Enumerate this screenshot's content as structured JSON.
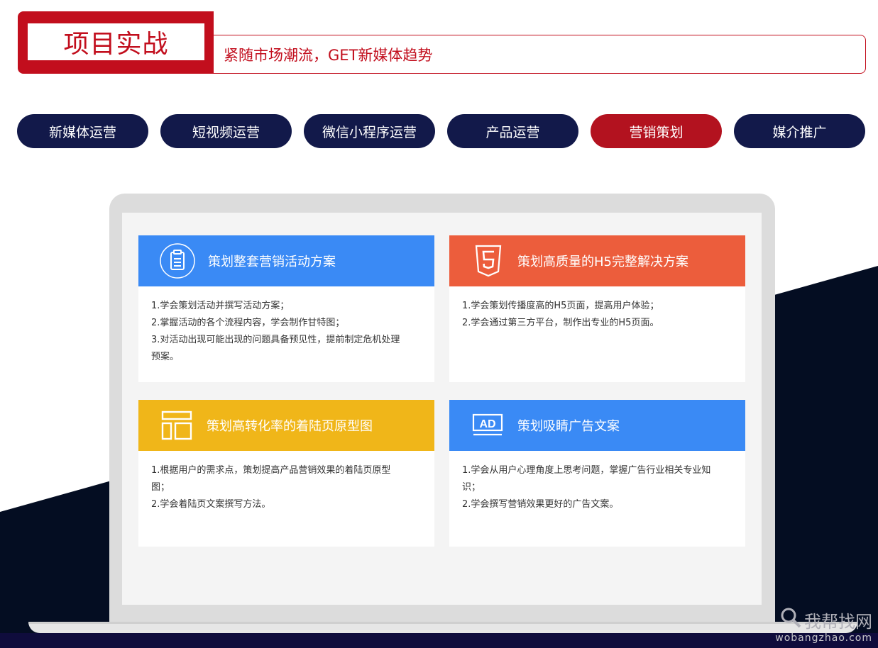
{
  "header": {
    "title": "项目实战",
    "subtitle": "紧随市场潮流，GET新媒体趋势"
  },
  "tabs": [
    {
      "label": "新媒体运营",
      "active": false
    },
    {
      "label": "短视频运营",
      "active": false
    },
    {
      "label": "微信小程序运营",
      "active": false
    },
    {
      "label": "产品运营",
      "active": false
    },
    {
      "label": "营销策划",
      "active": true
    },
    {
      "label": "媒介推广",
      "active": false
    }
  ],
  "cards": [
    {
      "icon": "clipboard-icon",
      "color": "#3a8af5",
      "title": "策划整套营销活动方案",
      "lines": [
        "1.学会策划活动并撰写活动方案；",
        "2.掌握活动的各个流程内容，学会制作甘特图；",
        "3.对活动出现可能出现的问题具备预见性，提前制定危机处理",
        "预案。"
      ]
    },
    {
      "icon": "html5-icon",
      "color": "#ec5d3c",
      "title": "策划高质量的H5完整解决方案",
      "lines": [
        "1.学会策划传播度高的H5页面，提高用户体验；",
        "2.学会通过第三方平台，制作出专业的H5页面。"
      ]
    },
    {
      "icon": "layout-icon",
      "color": "#f0b619",
      "title": "策划高转化率的着陆页原型图",
      "lines": [
        "1.根据用户的需求点，策划提高产品营销效果的着陆页原型",
        "图；",
        "2.学会着陆页文案撰写方法。"
      ]
    },
    {
      "icon": "ad-icon",
      "color": "#3a8af5",
      "title": "策划吸睛广告文案",
      "lines": [
        "1.学会从用户心理角度上思考问题，掌握广告行业相关专业知",
        "识；",
        "2.学会撰写营销效果更好的广告文案。"
      ]
    }
  ],
  "watermark": {
    "brand": "我帮找网",
    "url": "wobangzhao.com"
  }
}
